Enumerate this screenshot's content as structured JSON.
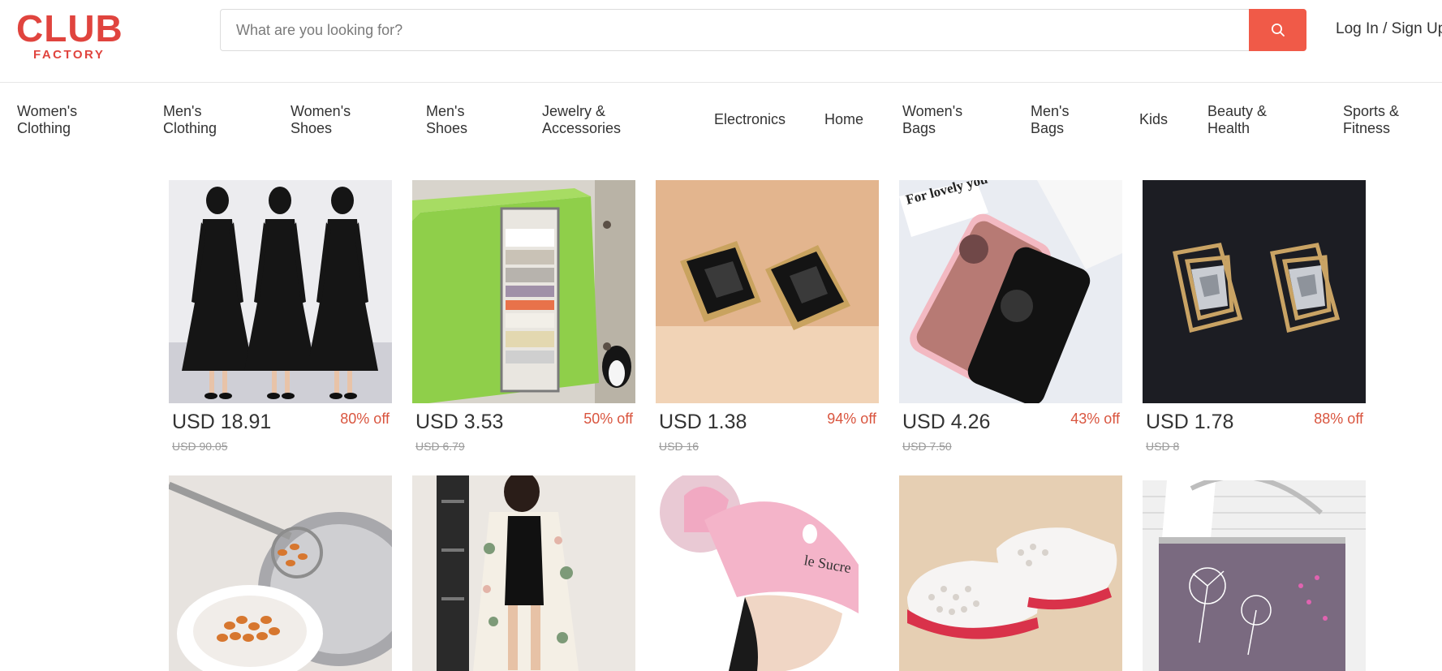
{
  "header": {
    "logo_main": "CLUB",
    "logo_sub": "FACTORY",
    "search_placeholder": "What are you looking for?",
    "search_value": "",
    "login_label": "Log In / Sign Up"
  },
  "categories": [
    {
      "line1": "Women's",
      "line2": "Clothing"
    },
    {
      "line1": "Men's",
      "line2": "Clothing"
    },
    {
      "line1": "Women's",
      "line2": "Shoes"
    },
    {
      "line1": "Men's",
      "line2": "Shoes"
    },
    {
      "line1": "Jewelry &",
      "line2": "Accessories"
    },
    {
      "line1": "Electronics",
      "line2": ""
    },
    {
      "line1": "Home",
      "line2": ""
    },
    {
      "line1": "Women's",
      "line2": "Bags"
    },
    {
      "line1": "Men's",
      "line2": "Bags"
    },
    {
      "line1": "Kids",
      "line2": ""
    },
    {
      "line1": "Beauty &",
      "line2": "Health"
    },
    {
      "line1": "Sports &",
      "line2": "Fitness"
    }
  ],
  "products": [
    {
      "image": "black-lace-dresses",
      "price": "USD 18.91",
      "old_price": "USD 90.05",
      "discount": "80% off"
    },
    {
      "image": "green-storage-bag",
      "price": "USD 3.53",
      "old_price": "USD 6.79",
      "discount": "50% off"
    },
    {
      "image": "black-crystal-earrings",
      "price": "USD 1.38",
      "old_price": "USD 16",
      "discount": "94% off"
    },
    {
      "image": "mirror-phone-case",
      "price": "USD 4.26",
      "old_price": "USD 7.50",
      "discount": "43% off"
    },
    {
      "image": "gold-crystal-earrings",
      "price": "USD 1.78",
      "old_price": "USD 8",
      "discount": "88% off"
    },
    {
      "image": "strainer-spoon",
      "price": "",
      "old_price": "",
      "discount": ""
    },
    {
      "image": "floral-kimono",
      "price": "",
      "old_price": "",
      "discount": ""
    },
    {
      "image": "pink-hair-towel",
      "price": "",
      "old_price": "",
      "discount": ""
    },
    {
      "image": "white-clog-sandals",
      "price": "",
      "old_price": "",
      "discount": ""
    },
    {
      "image": "dandelion-tote-bag",
      "price": "",
      "old_price": "",
      "discount": ""
    }
  ],
  "image_text": {
    "phone_note": "For lovely you~",
    "towel_text": "le Sucre"
  },
  "colors": {
    "brand": "#e0443e",
    "search_button": "#f05a48",
    "discount": "#d9553f"
  }
}
